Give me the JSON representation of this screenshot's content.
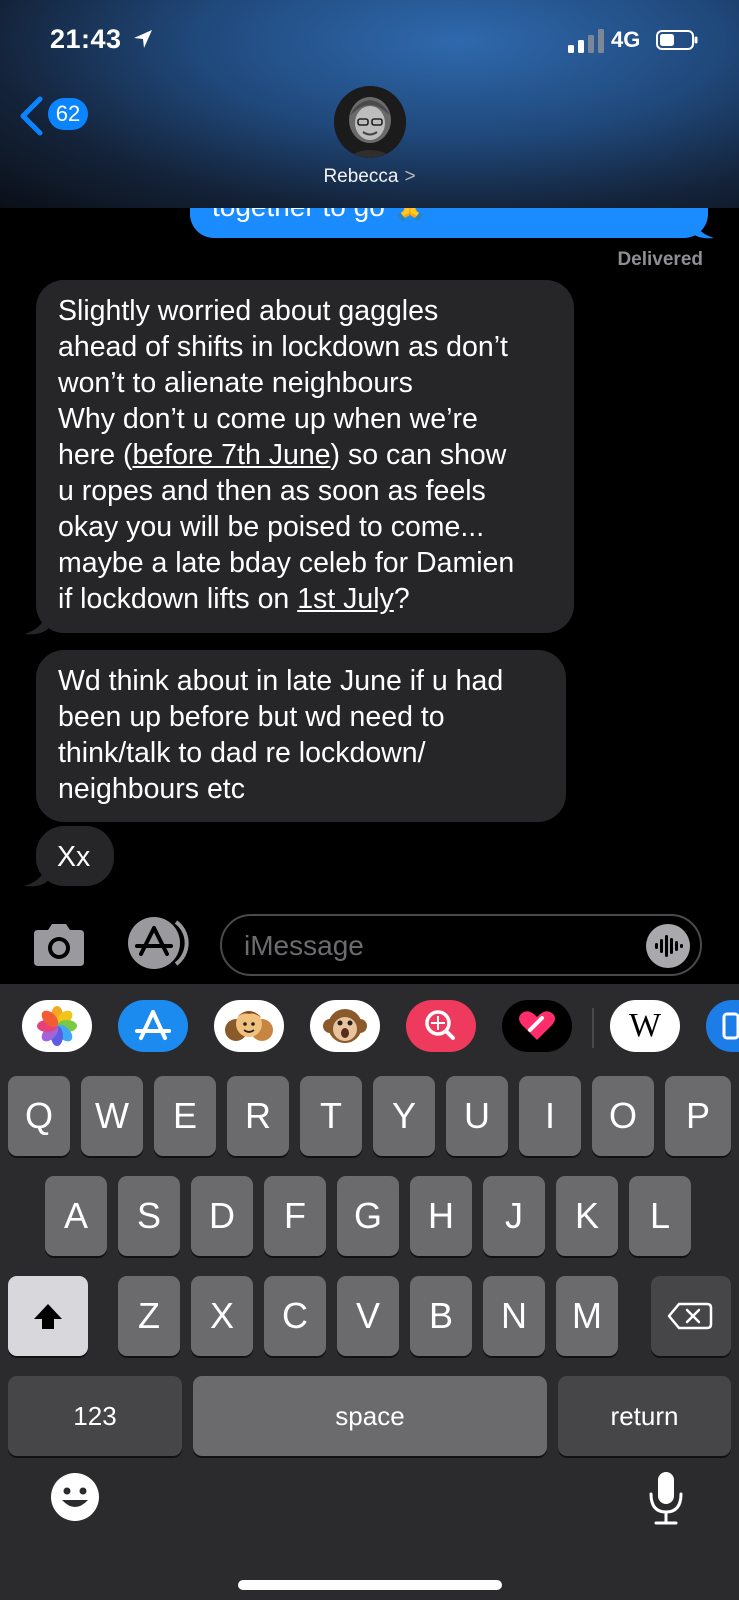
{
  "status_bar": {
    "time": "21:43",
    "network": "4G"
  },
  "nav": {
    "back_count": "62",
    "contact_name": "Rebecca",
    "contact_chevron": ">"
  },
  "conversation": {
    "sent_partial": "together to go 🙏",
    "delivered": "Delivered",
    "received": [
      {
        "lines": [
          {
            "text": "Slightly worried about gaggles"
          },
          {
            "text": "ahead of shifts in lockdown as don’t"
          },
          {
            "text": "won’t to alienate neighbours"
          },
          {
            "text": "Why don’t u come up when we’re"
          },
          {
            "pre": "here (",
            "link": "before 7th June",
            "post": ") so can show"
          },
          {
            "text": "u ropes and then as soon as feels"
          },
          {
            "text": "okay you will be poised to come..."
          },
          {
            "text": "maybe a late bday celeb for Damien"
          },
          {
            "pre": "if lockdown lifts on ",
            "link": "1st July",
            "post": "?"
          }
        ]
      },
      {
        "lines": [
          {
            "text": "Wd think about in late June if u had"
          },
          {
            "text": "been up before but wd need to"
          },
          {
            "text": "think/talk to dad re lockdown/"
          },
          {
            "text": "neighbours etc"
          }
        ]
      },
      {
        "lines": [
          {
            "text": "Xx"
          }
        ]
      }
    ]
  },
  "composer": {
    "placeholder": "iMessage"
  },
  "app_strip": [
    "photos-app",
    "app-store-app",
    "memoji-app",
    "animoji-app",
    "image-search-app",
    "digital-touch-app",
    "wikipedia-app",
    "more-app"
  ],
  "app_strip_glyphs": {
    "wikipedia": "W"
  },
  "keyboard": {
    "row1": [
      "Q",
      "W",
      "E",
      "R",
      "T",
      "Y",
      "U",
      "I",
      "O",
      "P"
    ],
    "row2": [
      "A",
      "S",
      "D",
      "F",
      "G",
      "H",
      "J",
      "K",
      "L"
    ],
    "row3": [
      "Z",
      "X",
      "C",
      "V",
      "B",
      "N",
      "M"
    ],
    "numbers": "123",
    "space": "space",
    "return": "return"
  },
  "colors": {
    "sent_bubble": "#1a8cff",
    "received_bubble": "#262628",
    "badge": "#0a84ff"
  }
}
